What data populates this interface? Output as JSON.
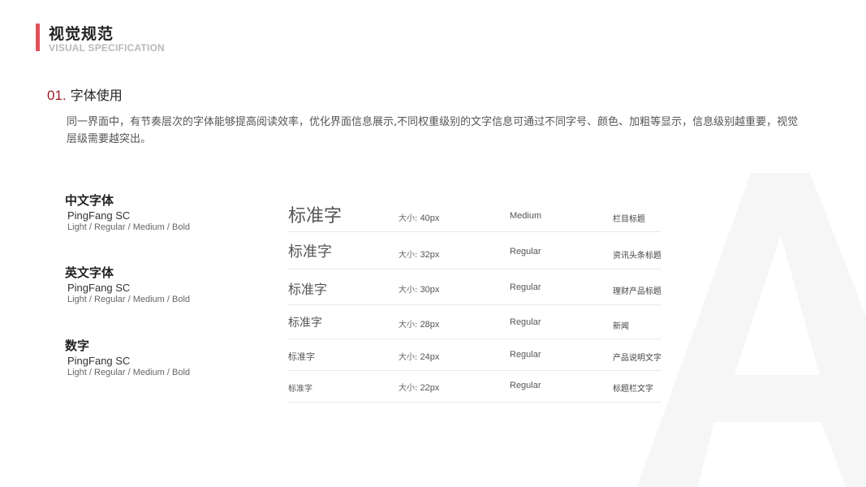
{
  "header": {
    "title_zh": "视觉规范",
    "title_en": "VISUAL SPECIFICATION"
  },
  "section": {
    "number": "01.",
    "title": "字体使用",
    "intro_line1": "同一界面中，有节奏层次的字体能够提高阅读效率，优化界面信息展示,不同权重级别的文字信息可通过不同字号、颜色、加粗等显示，信息级别越重要，视觉",
    "intro_line2": "层级需要越突出。"
  },
  "font_groups": [
    {
      "title": "中文字体",
      "name": "PingFang SC",
      "weights": "Light / Regular / Medium / Bold"
    },
    {
      "title": "英文字体",
      "name": "PingFang SC",
      "weights": "Light / Regular / Medium / Bold"
    },
    {
      "title": "数字",
      "name": "PingFang SC",
      "weights": "Light / Regular / Medium / Bold"
    }
  ],
  "size_label": "大小:",
  "specs": [
    {
      "sample": "标准字",
      "size": "40px",
      "weight": "Medium",
      "usage": "栏目标题"
    },
    {
      "sample": "标准字",
      "size": "32px",
      "weight": "Regular",
      "usage": "资讯头条标题"
    },
    {
      "sample": "标准字",
      "size": "30px",
      "weight": "Regular",
      "usage": "理财产品标题"
    },
    {
      "sample": "标准字",
      "size": "28px",
      "weight": "Regular",
      "usage": "新闻"
    },
    {
      "sample": "标准字",
      "size": "24px",
      "weight": "Regular",
      "usage": "产品说明文字"
    },
    {
      "sample": "标准字",
      "size": "22px",
      "weight": "Regular",
      "usage": "标题栏文字"
    }
  ],
  "colors": {
    "accent": "#e0525a",
    "number": "#9b1c24",
    "decor": "#f6f6f6"
  }
}
